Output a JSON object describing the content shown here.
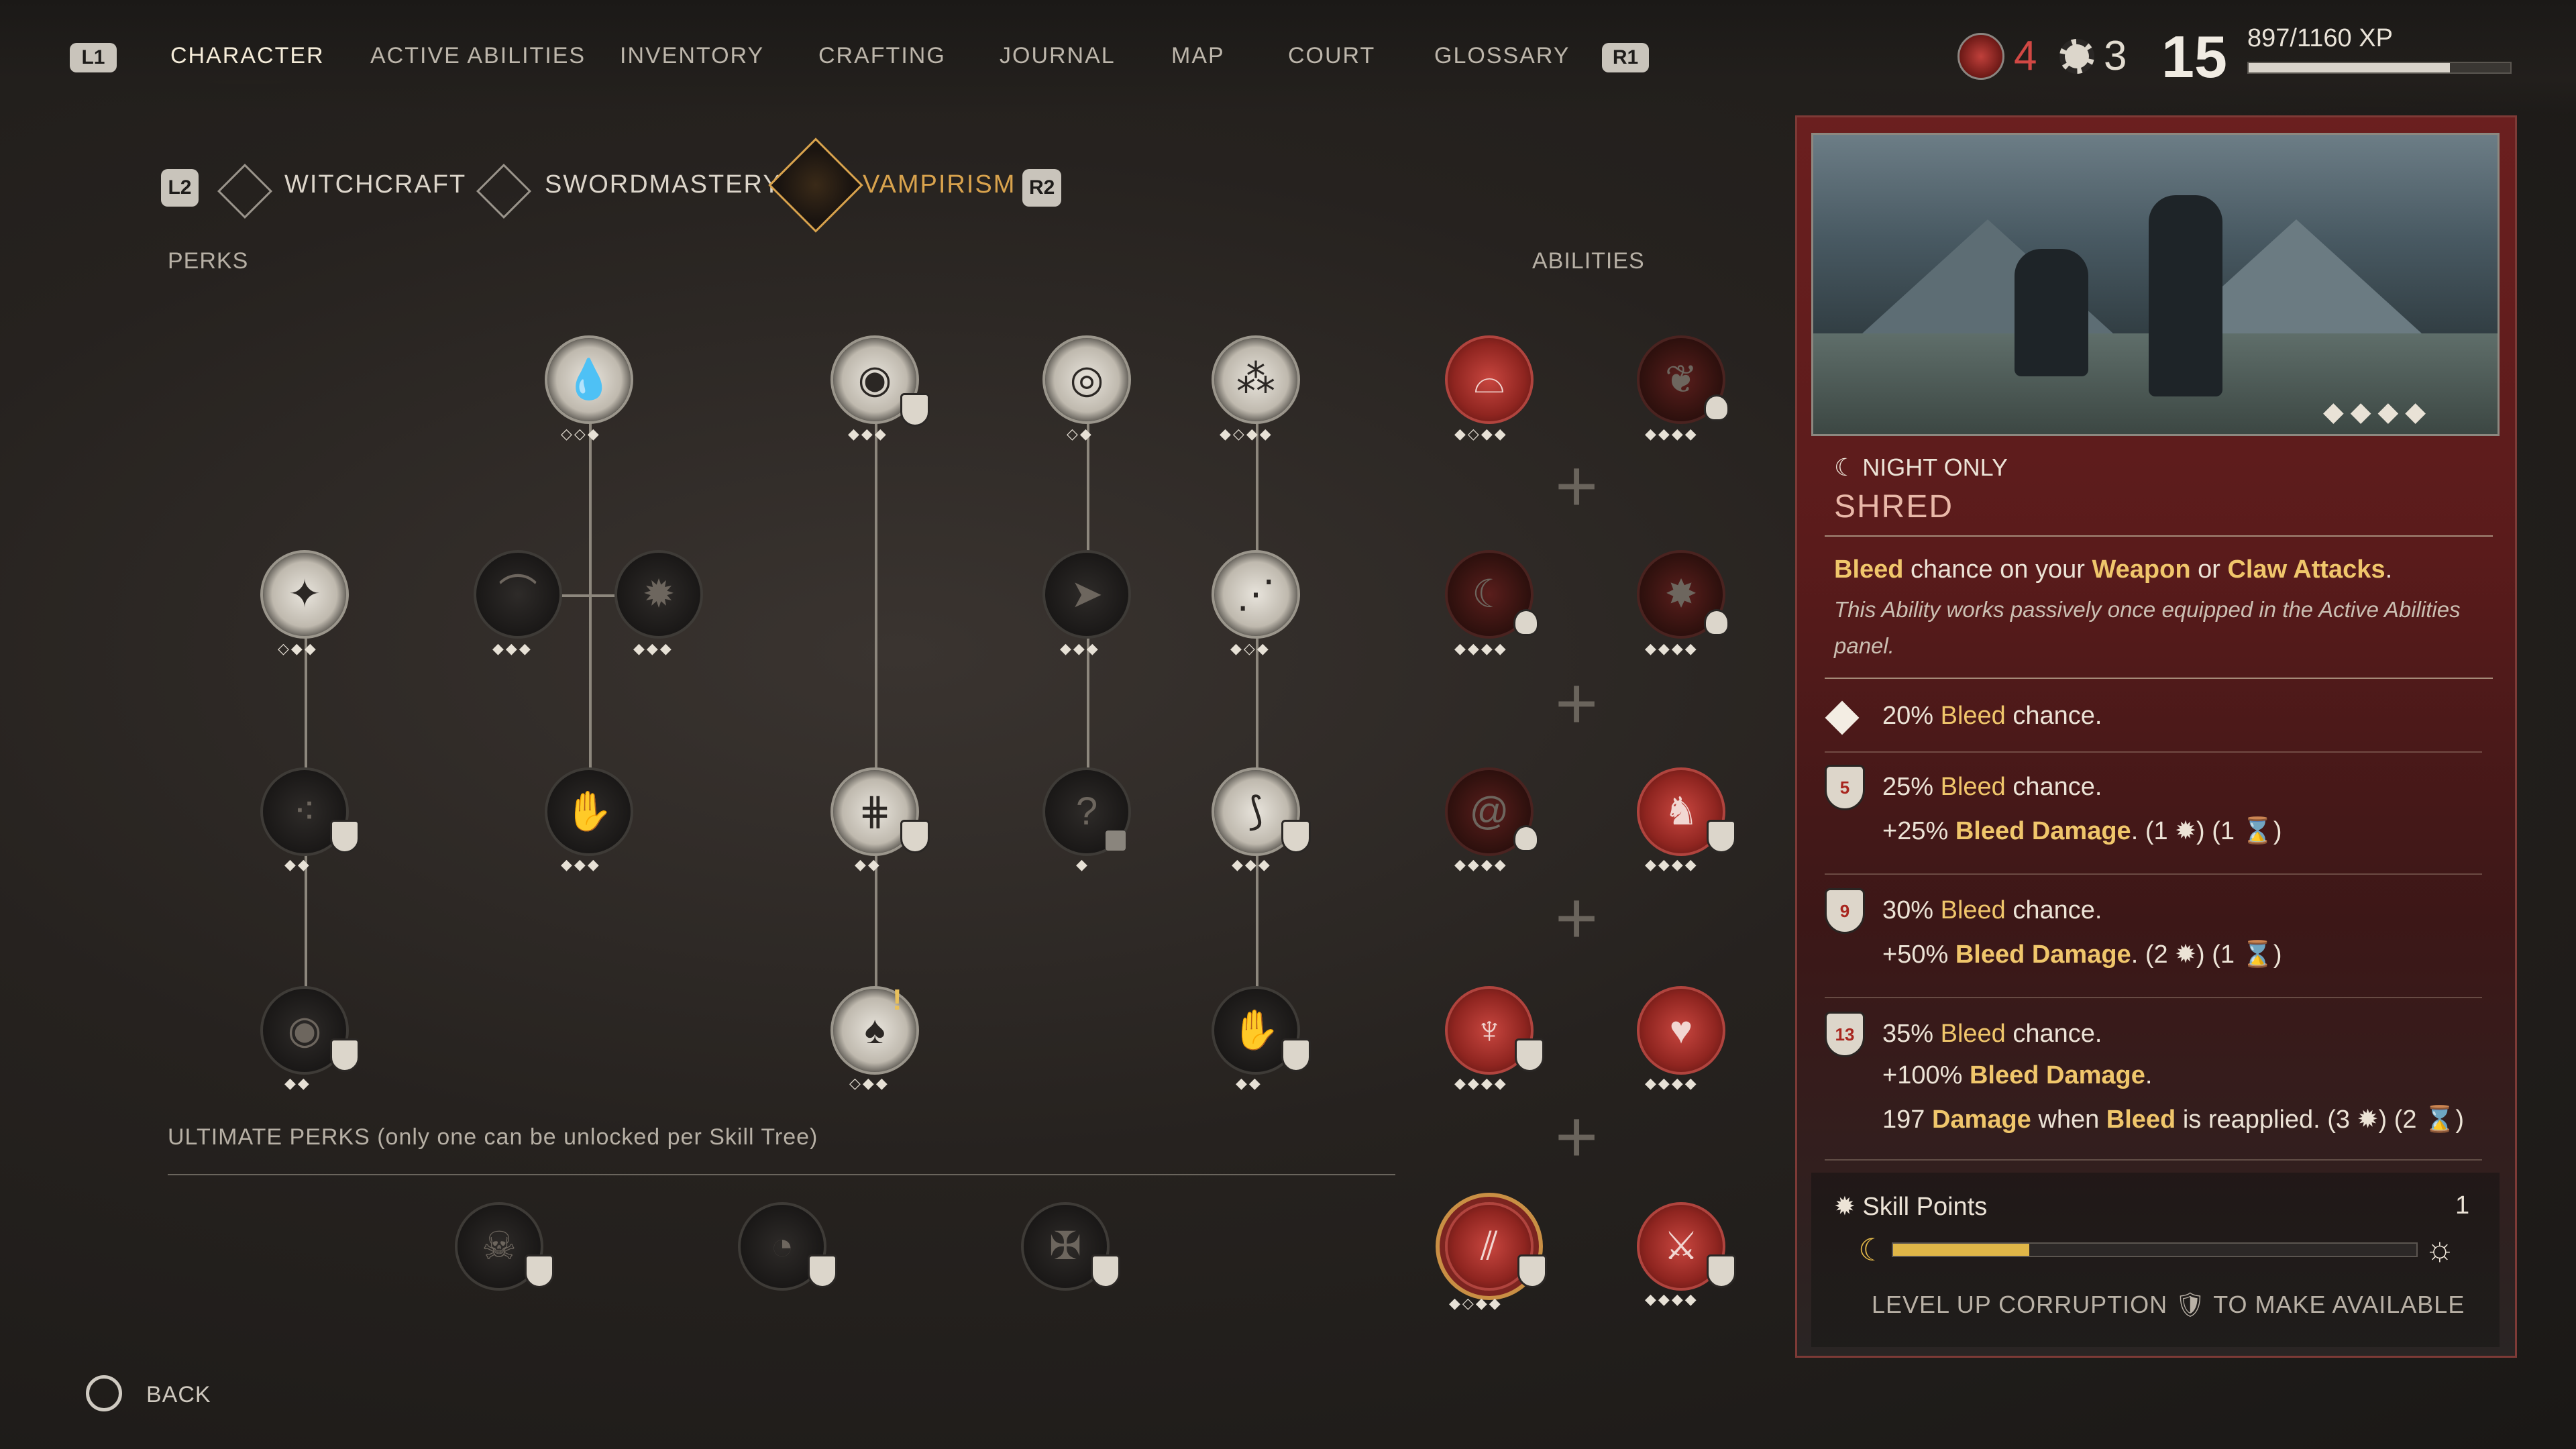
{
  "nav": {
    "left_button": "L1",
    "right_button": "R1",
    "tabs": [
      "CHARACTER",
      "ACTIVE ABILITIES",
      "INVENTORY",
      "CRAFTING",
      "JOURNAL",
      "MAP",
      "COURT",
      "GLOSSARY"
    ],
    "active_tab": "CHARACTER"
  },
  "stats": {
    "health_points": "4",
    "skill_points": "3",
    "level": "15",
    "xp_text": "897/1160 XP",
    "xp_fraction": 0.77
  },
  "skill_trees": {
    "left_button": "L2",
    "right_button": "R2",
    "tabs": [
      "WITCHCRAFT",
      "SWORDMASTERY",
      "VAMPIRISM"
    ],
    "active": "VAMPIRISM"
  },
  "labels": {
    "perks": "PERKS",
    "abilities": "ABILITIES",
    "ultimate_perks": "ULTIMATE PERKS (only one can be unlocked per Skill Tree)"
  },
  "detail": {
    "tag": "NIGHT ONLY",
    "title": "SHRED",
    "desc_parts": [
      "Bleed",
      " chance on your ",
      "Weapon",
      " or ",
      "Claw Attacks",
      "."
    ],
    "note": "This Ability works passively once equipped in the Active Abilities panel.",
    "tier1": {
      "parts": [
        "20% ",
        "Bleed",
        " chance."
      ]
    },
    "tier2": {
      "badge": "5",
      "line1": [
        "25% ",
        "Bleed",
        " chance."
      ],
      "line2": [
        "+25% ",
        "Bleed Damage",
        ". (1",
        ") (1",
        ")"
      ]
    },
    "tier3": {
      "badge": "9",
      "line1": [
        "30% ",
        "Bleed",
        " chance."
      ],
      "line2": [
        "+50% ",
        "Bleed Damage",
        ". (2",
        ") (1",
        ")"
      ]
    },
    "tier4": {
      "badge": "13",
      "line1": [
        "35% ",
        "Bleed",
        " chance."
      ],
      "line2": [
        "+100% ",
        "Bleed Damage",
        "."
      ],
      "line3": [
        "197 ",
        "Damage",
        " when ",
        "Bleed",
        " is reapplied. (3",
        ") (2",
        ")"
      ]
    },
    "skill_points_label": "Skill Points",
    "skill_points_value": "1",
    "corruption_fraction": 0.26,
    "footer_left": "LEVEL UP CORRUPTION",
    "footer_right": "TO MAKE AVAILABLE"
  },
  "back": {
    "label": "BACK"
  },
  "colors": {
    "accent_gold": "#d9a34d",
    "panel_red": "#6b1f1f",
    "highlight": "#f0c66b"
  }
}
